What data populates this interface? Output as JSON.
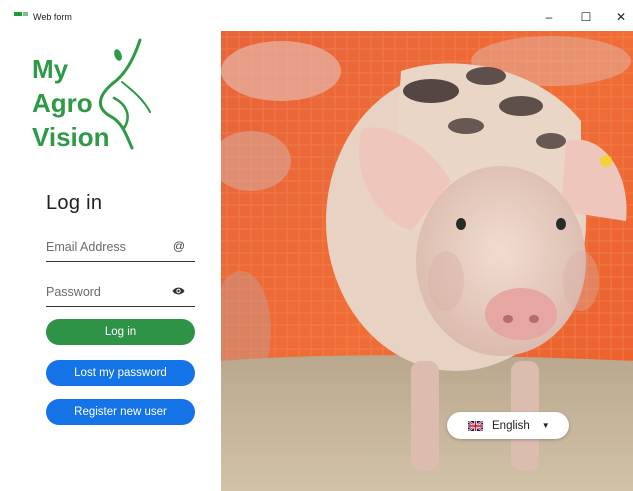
{
  "window": {
    "title": "Web form",
    "minimize": "–",
    "maximize": "☐",
    "close": "✕"
  },
  "brand": {
    "line1": "My",
    "line2": "Agro",
    "line3": "Vision",
    "color": "#2e9a46"
  },
  "login": {
    "heading": "Log in",
    "email_placeholder": "Email Address",
    "email_icon": "@",
    "password_placeholder": "Password",
    "password_icon": "eye-icon",
    "login_button": "Log in",
    "lost_password_button": "Lost my password",
    "register_button": "Register new user"
  },
  "language": {
    "selected": "English",
    "flag": "uk-flag-icon"
  },
  "colors": {
    "green": "#2e9346",
    "blue": "#1473e6"
  }
}
